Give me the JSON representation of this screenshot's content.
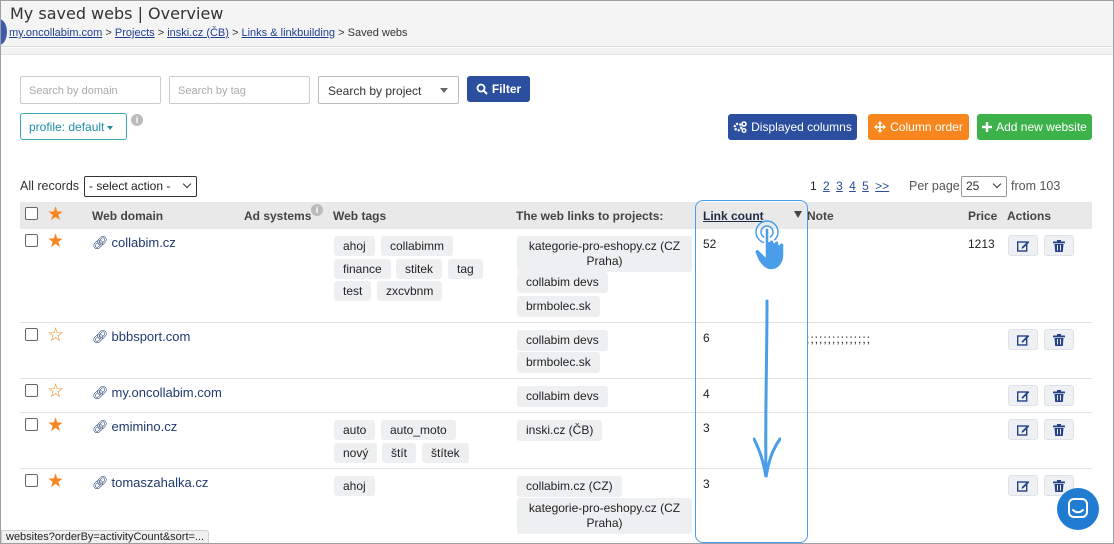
{
  "header": {
    "title": "My saved webs | Overview",
    "breadcrumb": {
      "root": "my.oncollabim.com",
      "projects": "Projects",
      "project": "inski.cz (ČB)",
      "section": "Links & linkbuilding",
      "current": "Saved webs",
      "separator": ">"
    }
  },
  "filters": {
    "domain_placeholder": "Search by domain",
    "tag_placeholder": "Search by tag",
    "project_select": "Search by project",
    "filter_button": "Filter",
    "profile": "profile: default"
  },
  "toolbar": {
    "displayed_columns": "Displayed columns",
    "column_order": "Column order",
    "add_new_website": "Add new website"
  },
  "list_controls": {
    "all_records": "All records",
    "action_select": "- select action -",
    "pages": [
      "1",
      "2",
      "3",
      "4",
      "5",
      ">>"
    ],
    "per_page_label": "Per page",
    "per_page_value": "25",
    "from_total": "from 103"
  },
  "table": {
    "headers": {
      "web_domain": "Web domain",
      "ad_systems": "Ad systems",
      "web_tags": "Web tags",
      "web_links": "The web links to projects:",
      "link_count": "Link count",
      "note": "Note",
      "price": "Price",
      "actions": "Actions"
    },
    "rows": [
      {
        "domain": "collabim.cz",
        "starred": true,
        "tags": [
          "ahoj",
          "collabimm",
          "finance",
          "stitek",
          "tag",
          "test",
          "zxcvbnm"
        ],
        "projects": [
          "kategorie-pro-eshopy.cz (CZ Praha)",
          "collabim devs",
          "brmbolec.sk"
        ],
        "link_count": "52",
        "note": "",
        "price": "1213"
      },
      {
        "domain": "bbbsport.com",
        "starred": false,
        "tags": [],
        "projects": [
          "collabim devs",
          "brmbolec.sk"
        ],
        "link_count": "6",
        "note": ";;;;;;;;;;;;;;;",
        "price": ""
      },
      {
        "domain": "my.oncollabim.com",
        "starred": false,
        "tags": [],
        "projects": [
          "collabim devs"
        ],
        "link_count": "4",
        "note": "",
        "price": ""
      },
      {
        "domain": "emimino.cz",
        "starred": true,
        "tags": [
          "auto",
          "auto_moto",
          "nový",
          "štít",
          "štítek"
        ],
        "projects": [
          "inski.cz (ČB)"
        ],
        "link_count": "3",
        "note": "",
        "price": ""
      },
      {
        "domain": "tomaszahalka.cz",
        "starred": true,
        "tags": [
          "ahoj"
        ],
        "projects": [
          "collabim.cz (CZ)",
          "kategorie-pro-eshopy.cz (CZ Praha)"
        ],
        "link_count": "3",
        "note": "",
        "price": ""
      }
    ]
  },
  "status_bar": {
    "url": "websites?orderBy=activityCount&sort=..."
  },
  "colors": {
    "primary": "#2b4f9e",
    "orange": "#f7861e",
    "green": "#3db24a",
    "teal": "#1f8ea5",
    "highlight": "#4a9de8",
    "star": "#f7861e"
  },
  "icons": [
    "search-icon",
    "gears-icon",
    "arrows-icon",
    "plus-icon",
    "link-icon",
    "star-icon",
    "edit-icon",
    "trash-icon",
    "info-icon",
    "hand-pointer-icon",
    "down-arrow-icon",
    "chat-icon"
  ]
}
